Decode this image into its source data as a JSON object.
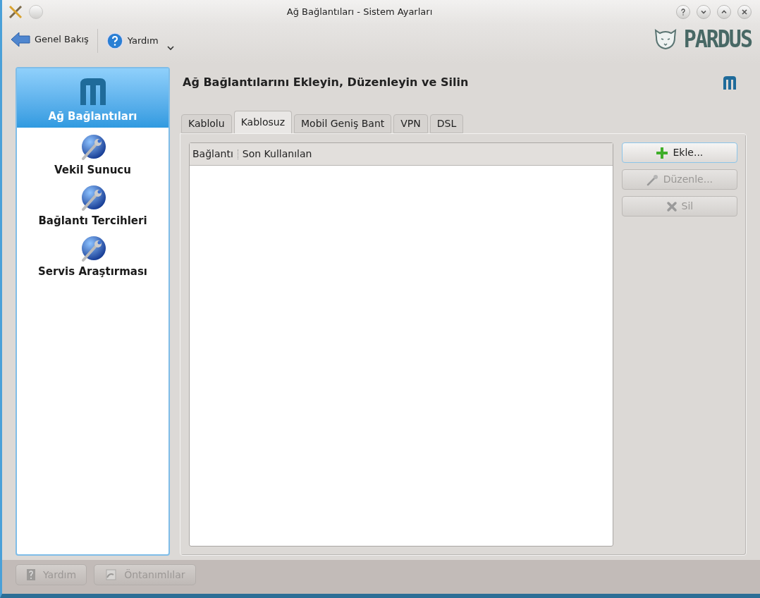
{
  "window": {
    "title": "Ağ Bağlantıları - Sistem Ayarları"
  },
  "toolbar": {
    "items": [
      {
        "kind": "back",
        "label": "Genel Bakış"
      },
      {
        "kind": "help",
        "label": "Yardım"
      }
    ],
    "logo": "PARDUS"
  },
  "sidebar": {
    "items": [
      {
        "kind": "network",
        "label": "Ağ Bağlantıları",
        "selected": true
      },
      {
        "kind": "globe",
        "label": "Vekil Sunucu",
        "selected": false
      },
      {
        "kind": "globe",
        "label": "Bağlantı Tercihleri",
        "selected": false
      },
      {
        "kind": "globe",
        "label": "Servis Araştırması",
        "selected": false
      }
    ]
  },
  "header": "Ağ Bağlantılarını Ekleyin, Düzenleyin ve Silin",
  "tabs": [
    {
      "label": "Kablolu",
      "selected": false
    },
    {
      "label": "Kablosuz",
      "selected": true
    },
    {
      "label": "Mobil Geniş Bant",
      "selected": false
    },
    {
      "label": "VPN",
      "selected": false
    },
    {
      "label": "DSL",
      "selected": false
    }
  ],
  "table": {
    "columns": [
      "Bağlantı",
      "Son Kullanılan"
    ]
  },
  "actions": [
    {
      "kind": "add",
      "label": "Ekle...",
      "disabled": false
    },
    {
      "kind": "edit",
      "label": "Düzenle...",
      "disabled": true
    },
    {
      "kind": "delete",
      "label": "Sil",
      "disabled": true
    }
  ],
  "footer": [
    {
      "kind": "help",
      "label": "Yardım",
      "disabled": true
    },
    {
      "kind": "defaults",
      "label": "Öntanımlılar",
      "disabled": true
    }
  ]
}
